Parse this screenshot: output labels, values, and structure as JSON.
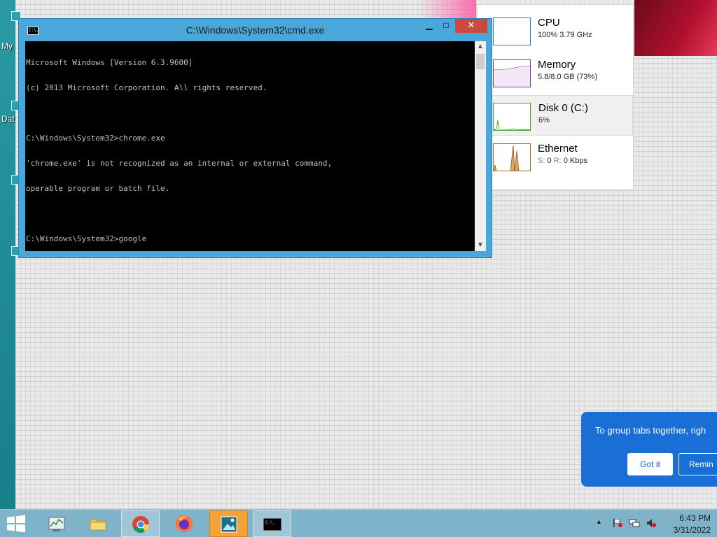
{
  "desktop": {
    "icon_labels": [
      "My",
      "Dat"
    ]
  },
  "task_manager": {
    "items": [
      {
        "name": "CPU",
        "value": "100%  3.79 GHz",
        "color": "#1c7ed6"
      },
      {
        "name": "Memory",
        "value": "5.8/8.0 GB (73%)",
        "color": "#8b3aa8"
      },
      {
        "name": "Disk 0 (C:)",
        "value": "6%",
        "color": "#4aa52e"
      },
      {
        "name": "Ethernet",
        "value_s": "S:",
        "value_s_num": "0",
        "value_r": "R:",
        "value_r_num": "0 Kbps",
        "color": "#a7692a"
      }
    ]
  },
  "cmd_window": {
    "title": "C:\\Windows\\System32\\cmd.exe",
    "minimize_glyph": "▁",
    "maximize_glyph": "□",
    "close_glyph": "✕",
    "output_lines": [
      "Microsoft Windows [Version 6.3.9600]",
      "(c) 2013 Microsoft Corporation. All rights reserved.",
      "",
      "C:\\Windows\\System32>chrome.exe",
      "'chrome.exe' is not recognized as an internal or external command,",
      "operable program or batch file.",
      "",
      "C:\\Windows\\System32>google"
    ],
    "icon_text": "C:\\."
  },
  "notification": {
    "message": "To group tabs together, righ",
    "got_it": "Got it",
    "remind": "Remin"
  },
  "taskbar": {
    "apps": [
      {
        "name": "task-manager",
        "active": false
      },
      {
        "name": "file-explorer",
        "active": false
      },
      {
        "name": "chrome",
        "active": true
      },
      {
        "name": "firefox",
        "active": false
      },
      {
        "name": "image-viewer",
        "active": false,
        "highlight": true
      },
      {
        "name": "command-prompt",
        "active": true
      }
    ],
    "tray_up_glyph": "▲",
    "clock_time": "6:43 PM",
    "clock_date": "3/31/2022"
  },
  "colors": {
    "taskbar": "#7fb3c9",
    "cmd_frame": "#4aa7d9",
    "close_button": "#c94b3f",
    "toast": "#1a6fd6"
  }
}
